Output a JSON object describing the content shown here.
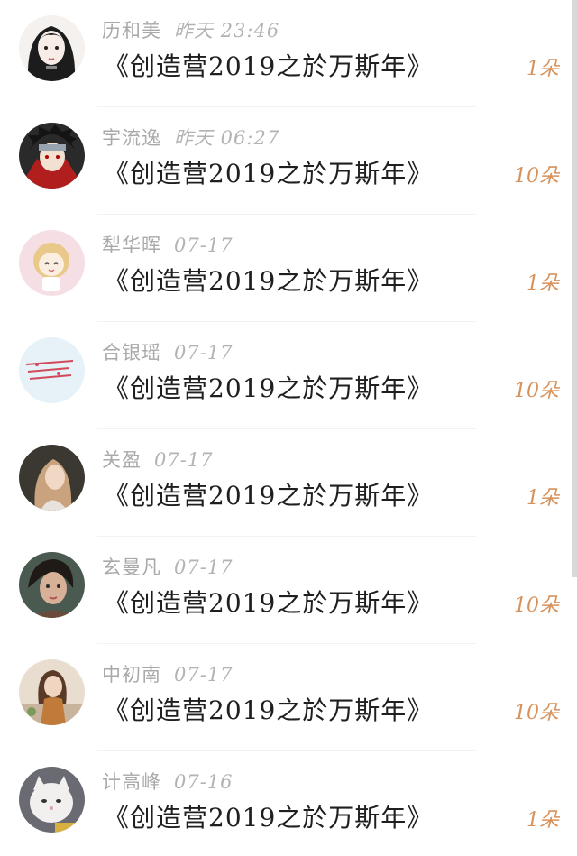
{
  "title_text": "《创造营2019之於万斯年》",
  "accent_color": "#d7925c",
  "items": [
    {
      "name": "历和美",
      "time": "昨天 23:46",
      "title": "《创造营2019之於万斯年》",
      "gift": "1朵"
    },
    {
      "name": "宇流逸",
      "time": "昨天 06:27",
      "title": "《创造营2019之於万斯年》",
      "gift": "10朵"
    },
    {
      "name": "犁华晖",
      "time": "07-17",
      "title": "《创造营2019之於万斯年》",
      "gift": "1朵"
    },
    {
      "name": "合银瑶",
      "time": "07-17",
      "title": "《创造营2019之於万斯年》",
      "gift": "10朵"
    },
    {
      "name": "关盈",
      "time": "07-17",
      "title": "《创造营2019之於万斯年》",
      "gift": "1朵"
    },
    {
      "name": "玄曼凡",
      "time": "07-17",
      "title": "《创造营2019之於万斯年》",
      "gift": "10朵"
    },
    {
      "name": "中初南",
      "time": "07-17",
      "title": "《创造营2019之於万斯年》",
      "gift": "10朵"
    },
    {
      "name": "计高峰",
      "time": "07-16",
      "title": "《创造营2019之於万斯年》",
      "gift": "1朵"
    }
  ]
}
